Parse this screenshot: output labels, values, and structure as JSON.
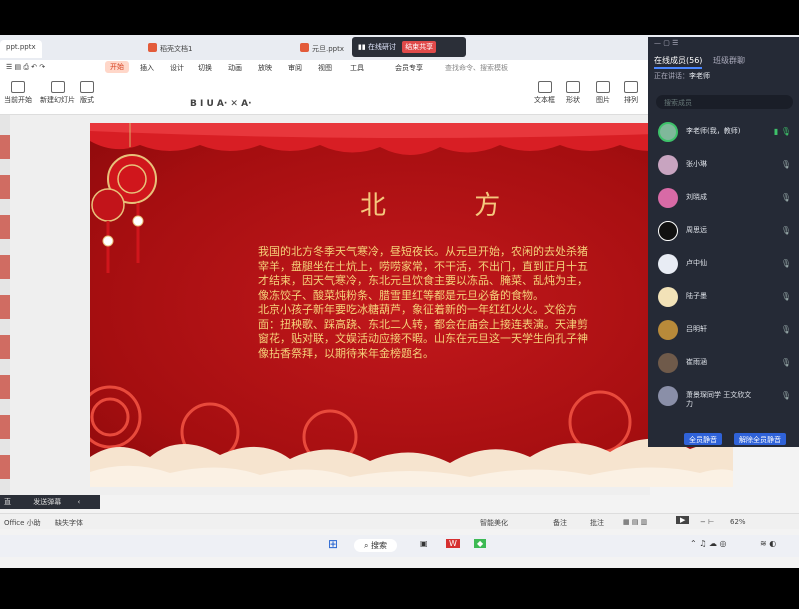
{
  "window": {
    "file_tab": "ppt.pptx",
    "tab2": "稻壳文档1",
    "tab3": "元旦.pptx",
    "meeting_title": "在线研讨",
    "meeting_badge": "结束共享"
  },
  "menu": {
    "items": [
      "开始",
      "插入",
      "设计",
      "切换",
      "动画",
      "放映",
      "审阅",
      "视图",
      "工具",
      "会员专享"
    ],
    "search": "查找命令、搜索模板"
  },
  "ribbon": {
    "buttons": [
      "当前开始",
      "新建幻灯片",
      "版式",
      "文本框",
      "形状",
      "图片",
      "排列"
    ]
  },
  "slide": {
    "title": "北 方",
    "paragraph1": "我国的北方冬季天气寒冷，昼短夜长。从元旦开始，农闲的去处杀猪宰羊，盘腿坐在土炕上，唠唠家常，不干活，不出门，直到正月十五才结束，因天气寒冷，东北元旦饮食主要以冻品、腌菜、乱炖为主，像冻饺子、酸菜炖粉条、腊雪里红等都是元旦必备的食物。",
    "paragraph2": "北京小孩子新年要吃冰糖葫芦，象征着新的一年红红火火。文俗方面：扭秧歌、踩高跷、东北二人转，都会在庙会上接连表演。天津剪窗花，贴对联，文娱活动应接不暇。山东在元旦这一天学生向孔子神像拈香祭拜，以期待来年金榜题名。"
  },
  "panel": {
    "tab_members": "在线成员(56)",
    "tab_settings": "班级群聊",
    "speaking_label": "正在讲话：",
    "speaking_name": "李老师",
    "search_placeholder": "搜索成员",
    "members": [
      "李老师(我，教师)",
      "张小琳",
      "刘晓成",
      "周思远",
      "卢中仙",
      "陆子墨",
      "吕明轩",
      "崔雨涵",
      "萧景琛同学 王文欣文力"
    ],
    "btn_all_mute": "全员静音",
    "btn_mute_off": "解除全员静音"
  },
  "bottom": {
    "panel_label": "发送弹幕",
    "panel_left": "直",
    "office": "Office 小助",
    "fonts": "缺失字体",
    "smart": "智能美化",
    "notes": "备注",
    "comments": "批注",
    "zoom": "62%",
    "search_taskbar": "搜索"
  },
  "colors": {
    "slide_red": "#b3121a",
    "gold_text": "#f5d27a",
    "panel_bg": "#252a36",
    "accent_blue": "#2f62d8"
  }
}
